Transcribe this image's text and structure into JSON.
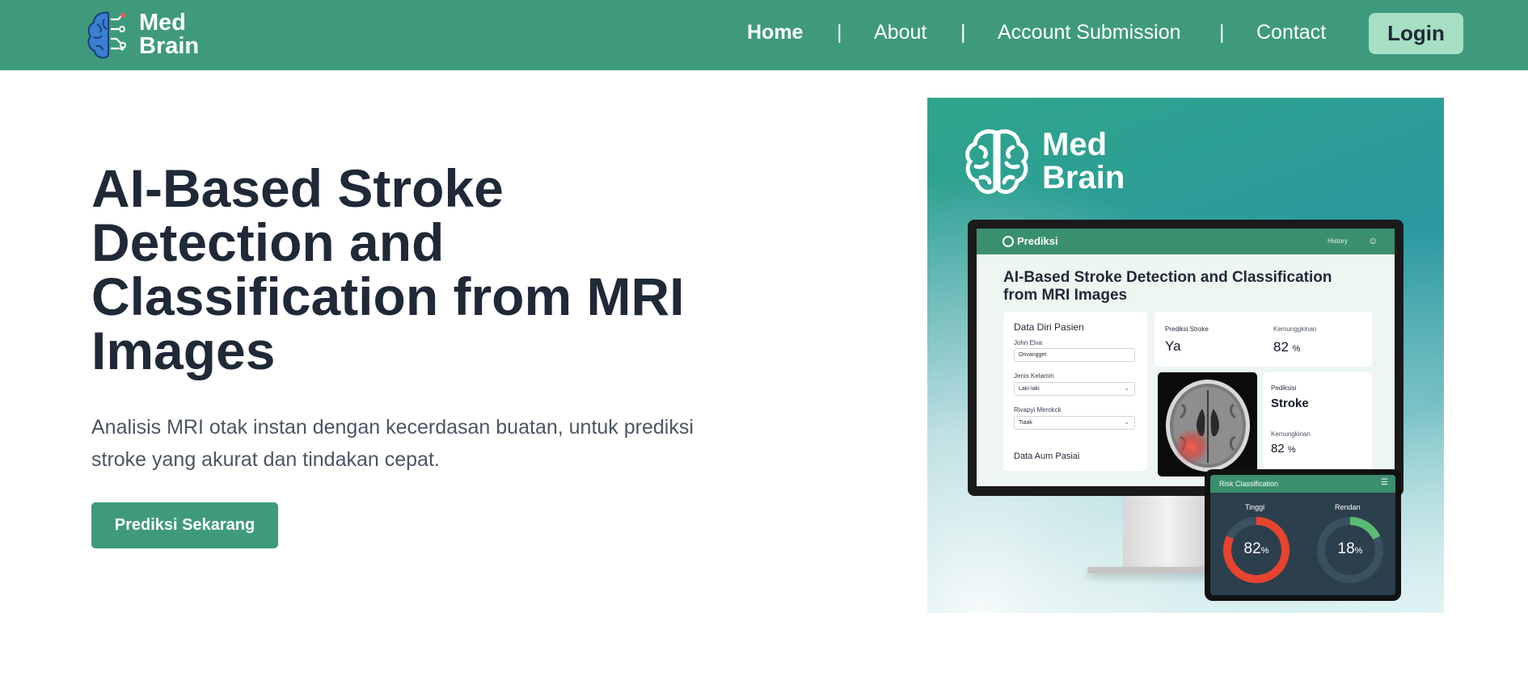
{
  "brand": {
    "name_line1": "Med",
    "name_line2": "Brain"
  },
  "nav": {
    "items": [
      {
        "label": "Home",
        "active": true
      },
      {
        "label": "About",
        "active": false
      },
      {
        "label": "Account Submission",
        "active": false
      },
      {
        "label": "Contact",
        "active": false
      }
    ],
    "separator": "|",
    "login_label": "Login"
  },
  "hero": {
    "title": "AI-Based Stroke Detection and Classification from MRI Images",
    "description": "Analisis MRI otak instan dengan kecerdasan buatan, untuk prediksi stroke yang akurat dan tindakan cepat.",
    "cta_label": "Prediksi Sekarang"
  },
  "illustration": {
    "logo_line1": "Med",
    "logo_line2": "Brain",
    "app": {
      "bar_title": "Prediksi",
      "history_label": "History",
      "title": "AI-Based Stroke Detection and Classification from MRI Images",
      "form": {
        "title": "Data Diri Pasien",
        "fields": [
          {
            "label": "John Elva",
            "value": "Onvangget"
          },
          {
            "label": "Jenis Kelamin",
            "value": "Laki-laki"
          },
          {
            "label": "Rivapyi Merokck",
            "value": "Tiaak"
          }
        ],
        "footer": "Data Aum Pasiai"
      },
      "prediction": {
        "label": "Prediksi Stroke",
        "value": "Ya"
      },
      "likelihood": {
        "label": "Kemunggkinan",
        "value": "82",
        "unit": "%"
      },
      "prediction2": {
        "label": "Pediksisi",
        "value": "Stroke"
      },
      "likelihood2": {
        "label": "Kemungkinan",
        "value": "82",
        "unit": "%"
      }
    },
    "tablet": {
      "title": "Risk Classification",
      "menu_icon": "hamburger-icon",
      "gauges": [
        {
          "label": "Tinggi",
          "value": "82",
          "unit": "%",
          "fraction": 0.82,
          "color": "#e8432e"
        },
        {
          "label": "Rendan",
          "value": "18",
          "unit": "%",
          "fraction": 0.18,
          "color": "#5cbb72"
        }
      ]
    }
  },
  "colors": {
    "primary": "#3f9a7d",
    "login_button": "#a6dfc4",
    "heading": "#1f2937",
    "body_text": "#4b5563"
  }
}
